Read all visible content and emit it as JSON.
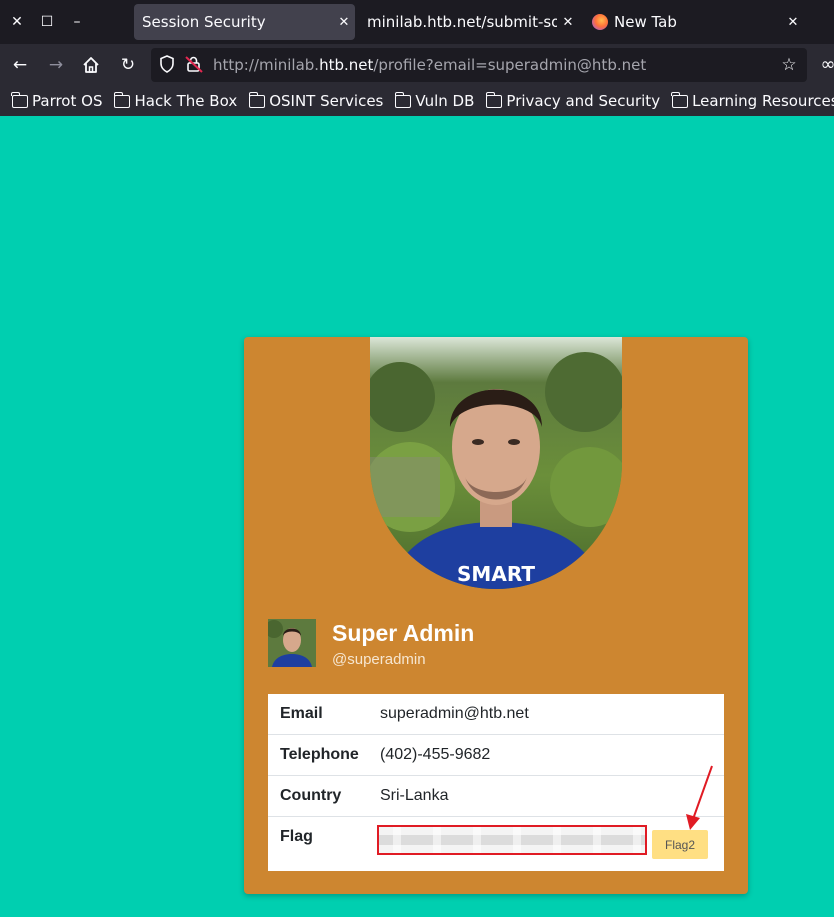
{
  "tabs": [
    {
      "label": "Session Security",
      "active": true
    },
    {
      "label": "minilab.htb.net/submit-solut",
      "active": false
    },
    {
      "label": "New Tab",
      "active": false
    }
  ],
  "url": {
    "prefix": "http://minilab.",
    "host": "htb.net",
    "path": "/profile?email=superadmin@htb.net"
  },
  "bookmarks": [
    "Parrot OS",
    "Hack The Box",
    "OSINT Services",
    "Vuln DB",
    "Privacy and Security",
    "Learning Resources"
  ],
  "profile": {
    "name": "Super Admin",
    "handle": "@superadmin",
    "shirt_text": "SMART"
  },
  "info": {
    "email_label": "Email",
    "email_value": "superadmin@htb.net",
    "telephone_label": "Telephone",
    "telephone_value": "(402)-455-9682",
    "country_label": "Country",
    "country_value": "Sri-Lanka",
    "flag_label": "Flag",
    "flag_button": "Flag2"
  },
  "colors": {
    "page_bg": "#00cfb0",
    "card_bg": "#cd8630",
    "flag_button_bg": "#ffdf83",
    "highlight": "#e01b24"
  }
}
